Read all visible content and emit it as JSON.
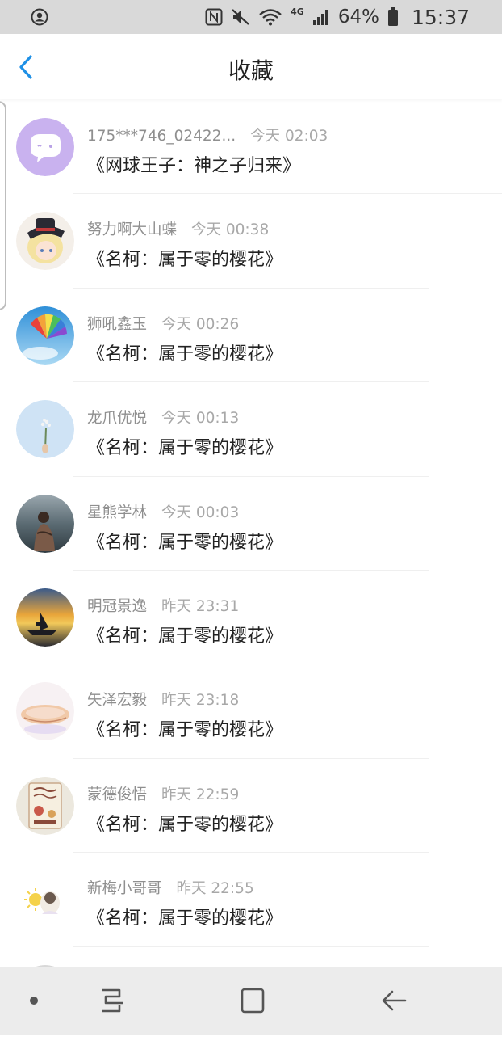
{
  "status_bar": {
    "battery_percent": "64%",
    "time": "15:37",
    "network": "4G"
  },
  "header": {
    "title": "收藏"
  },
  "items": [
    {
      "user": "175***746_02422...",
      "time": "今天 02:03",
      "book": "《网球王子：神之子归来》",
      "avatar": "purple-chat-bubble"
    },
    {
      "user": "努力啊大山蝶",
      "time": "今天 00:38",
      "book": "《名柯：属于零的樱花》",
      "avatar": "anime-boy-hat"
    },
    {
      "user": "狮吼鑫玉",
      "time": "今天 00:26",
      "book": "《名柯：属于零的樱花》",
      "avatar": "rainbow-fan-sky"
    },
    {
      "user": "龙爪优悦",
      "time": "今天 00:13",
      "book": "《名柯：属于零的樱花》",
      "avatar": "flowers-sky"
    },
    {
      "user": "星熊学林",
      "time": "今天 00:03",
      "book": "《名柯：属于零的樱花》",
      "avatar": "person-by-water"
    },
    {
      "user": "明冠景逸",
      "time": "昨天 23:31",
      "book": "《名柯：属于零的樱花》",
      "avatar": "sunset-boat"
    },
    {
      "user": "矢泽宏毅",
      "time": "昨天 23:18",
      "book": "《名柯：属于零的樱花》",
      "avatar": "anime-lying-girl"
    },
    {
      "user": "蒙德俊悟",
      "time": "昨天 22:59",
      "book": "《名柯：属于零的樱花》",
      "avatar": "vintage-poster"
    },
    {
      "user": "新梅小哥哥",
      "time": "昨天 22:55",
      "book": "《名柯：属于零的樱花》",
      "avatar": "sun-character"
    },
    {
      "user": "",
      "time": "",
      "book": "",
      "avatar": "partial"
    }
  ],
  "colors": {
    "accent": "#1e90e6",
    "status_bar_bg": "#d9d9d9",
    "nav_bar_bg": "#ececec",
    "meta_text": "#8f8f8f",
    "title_text": "#222222"
  }
}
